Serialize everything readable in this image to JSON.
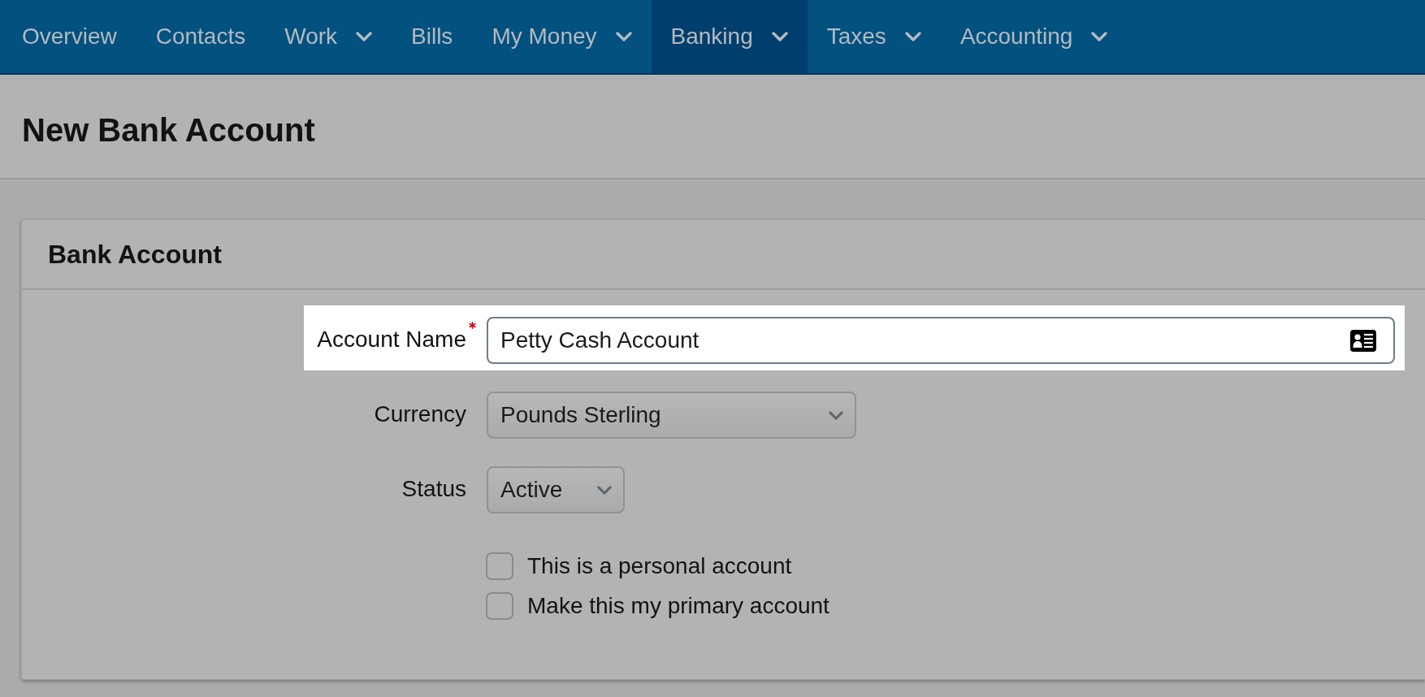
{
  "nav": {
    "items": [
      {
        "label": "Overview",
        "menu": false,
        "selected": false
      },
      {
        "label": "Contacts",
        "menu": false,
        "selected": false
      },
      {
        "label": "Work",
        "menu": true,
        "selected": false
      },
      {
        "label": "Bills",
        "menu": false,
        "selected": false
      },
      {
        "label": "My Money",
        "menu": true,
        "selected": false
      },
      {
        "label": "Banking",
        "menu": true,
        "selected": true
      },
      {
        "label": "Taxes",
        "menu": true,
        "selected": false
      },
      {
        "label": "Accounting",
        "menu": true,
        "selected": false
      }
    ]
  },
  "page": {
    "title": "New Bank Account"
  },
  "card": {
    "title": "Bank Account",
    "fields": [
      {
        "kind": "text",
        "label": "Account Name",
        "required": true,
        "highlighted": true,
        "value": "Petty Cash Account"
      },
      {
        "kind": "select",
        "label": "Currency",
        "required": false,
        "highlighted": false,
        "value": "Pounds Sterling"
      },
      {
        "kind": "select",
        "label": "Status",
        "required": false,
        "highlighted": false,
        "value": "Active"
      }
    ],
    "checkboxes": [
      {
        "label": "This is a personal account",
        "checked": false
      },
      {
        "label": "Make this my primary account",
        "checked": false
      }
    ]
  }
}
